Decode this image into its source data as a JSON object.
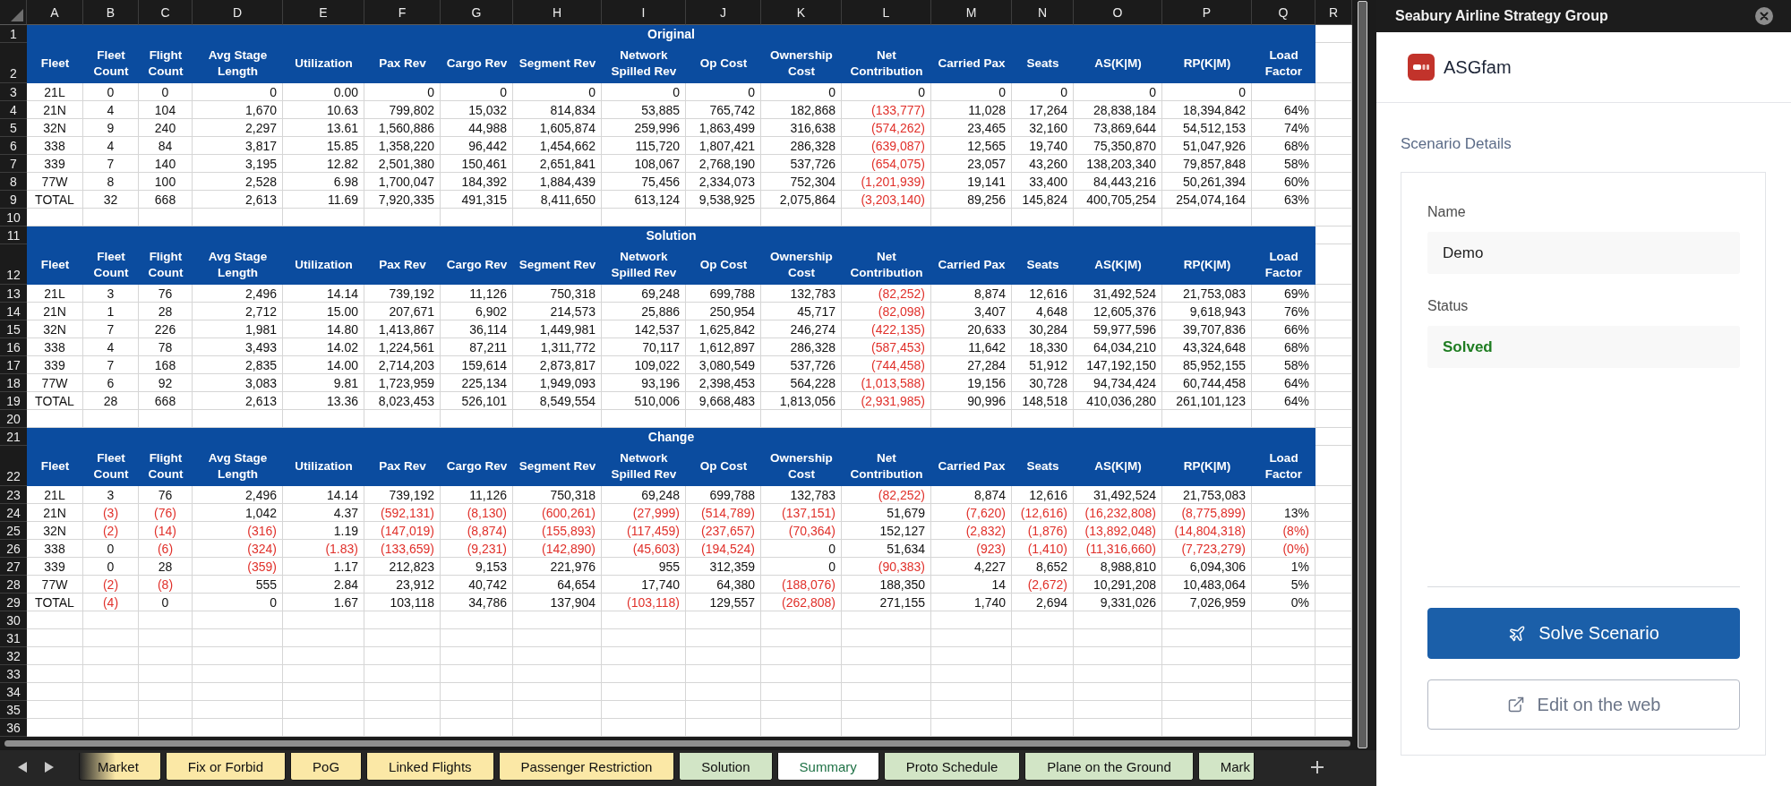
{
  "sheet": {
    "columns": [
      "A",
      "B",
      "C",
      "D",
      "E",
      "F",
      "G",
      "H",
      "I",
      "J",
      "K",
      "L",
      "M",
      "N",
      "O",
      "P",
      "Q",
      "R"
    ],
    "rows": [
      {
        "number": "1",
        "kind": "title",
        "title": "Original"
      },
      {
        "number": "2",
        "kind": "header",
        "cells": [
          "Fleet",
          "Fleet Count",
          "Flight Count",
          "Avg Stage Length",
          "Utilization",
          "Pax Rev",
          "Cargo Rev",
          "Segment Rev",
          "Network Spilled Rev",
          "Op Cost",
          "Ownership Cost",
          "Net Contribution",
          "Carried Pax",
          "Seats",
          "AS(K|M)",
          "RP(K|M)",
          "Load Factor"
        ]
      },
      {
        "number": "3",
        "kind": "data",
        "cells": [
          "21L",
          "0",
          "0",
          "0",
          "0.00",
          "0",
          "0",
          "0",
          "0",
          "0",
          "0",
          "0",
          "0",
          "0",
          "0",
          "0"
        ],
        "negative": [
          false,
          false,
          false,
          false,
          false,
          false,
          false,
          false,
          false,
          false,
          false,
          false,
          false,
          false,
          false,
          false
        ]
      },
      {
        "number": "4",
        "kind": "data",
        "cells": [
          "21N",
          "4",
          "104",
          "1,670",
          "10.63",
          "799,802",
          "15,032",
          "814,834",
          "53,885",
          "765,742",
          "182,868",
          "(133,777)",
          "11,028",
          "17,264",
          "28,838,184",
          "18,394,842",
          "64%"
        ],
        "negative": [
          false,
          false,
          false,
          false,
          false,
          false,
          false,
          false,
          false,
          false,
          false,
          true,
          false,
          false,
          false,
          false,
          false
        ]
      },
      {
        "number": "5",
        "kind": "data",
        "cells": [
          "32N",
          "9",
          "240",
          "2,297",
          "13.61",
          "1,560,886",
          "44,988",
          "1,605,874",
          "259,996",
          "1,863,499",
          "316,638",
          "(574,262)",
          "23,465",
          "32,160",
          "73,869,644",
          "54,512,153",
          "74%"
        ],
        "negative": [
          false,
          false,
          false,
          false,
          false,
          false,
          false,
          false,
          false,
          false,
          false,
          true,
          false,
          false,
          false,
          false,
          false
        ]
      },
      {
        "number": "6",
        "kind": "data",
        "cells": [
          "338",
          "4",
          "84",
          "3,817",
          "15.85",
          "1,358,220",
          "96,442",
          "1,454,662",
          "115,720",
          "1,807,421",
          "286,328",
          "(639,087)",
          "12,565",
          "19,740",
          "75,350,870",
          "51,047,926",
          "68%"
        ],
        "negative": [
          false,
          false,
          false,
          false,
          false,
          false,
          false,
          false,
          false,
          false,
          false,
          true,
          false,
          false,
          false,
          false,
          false
        ]
      },
      {
        "number": "7",
        "kind": "data",
        "cells": [
          "339",
          "7",
          "140",
          "3,195",
          "12.82",
          "2,501,380",
          "150,461",
          "2,651,841",
          "108,067",
          "2,768,190",
          "537,726",
          "(654,075)",
          "23,057",
          "43,260",
          "138,203,340",
          "79,857,848",
          "58%"
        ],
        "negative": [
          false,
          false,
          false,
          false,
          false,
          false,
          false,
          false,
          false,
          false,
          false,
          true,
          false,
          false,
          false,
          false,
          false
        ]
      },
      {
        "number": "8",
        "kind": "data",
        "cells": [
          "77W",
          "8",
          "100",
          "2,528",
          "6.98",
          "1,700,047",
          "184,392",
          "1,884,439",
          "75,456",
          "2,334,073",
          "752,304",
          "(1,201,939)",
          "19,141",
          "33,400",
          "84,443,216",
          "50,261,394",
          "60%"
        ],
        "negative": [
          false,
          false,
          false,
          false,
          false,
          false,
          false,
          false,
          false,
          false,
          false,
          true,
          false,
          false,
          false,
          false,
          false
        ]
      },
      {
        "number": "9",
        "kind": "data",
        "cells": [
          "TOTAL",
          "32",
          "668",
          "2,613",
          "11.69",
          "7,920,335",
          "491,315",
          "8,411,650",
          "613,124",
          "9,538,925",
          "2,075,864",
          "(3,203,140)",
          "89,256",
          "145,824",
          "400,705,254",
          "254,074,164",
          "63%"
        ],
        "negative": [
          false,
          false,
          false,
          false,
          false,
          false,
          false,
          false,
          false,
          false,
          false,
          true,
          false,
          false,
          false,
          false,
          false
        ]
      },
      {
        "number": "10",
        "kind": "empty"
      },
      {
        "number": "11",
        "kind": "title",
        "title": "Solution"
      },
      {
        "number": "12",
        "kind": "header",
        "cells": [
          "Fleet",
          "Fleet Count",
          "Flight Count",
          "Avg Stage Length",
          "Utilization",
          "Pax Rev",
          "Cargo Rev",
          "Segment Rev",
          "Network Spilled Rev",
          "Op Cost",
          "Ownership Cost",
          "Net Contribution",
          "Carried Pax",
          "Seats",
          "AS(K|M)",
          "RP(K|M)",
          "Load Factor"
        ]
      },
      {
        "number": "13",
        "kind": "data",
        "cells": [
          "21L",
          "3",
          "76",
          "2,496",
          "14.14",
          "739,192",
          "11,126",
          "750,318",
          "69,248",
          "699,788",
          "132,783",
          "(82,252)",
          "8,874",
          "12,616",
          "31,492,524",
          "21,753,083",
          "69%"
        ],
        "negative": [
          false,
          false,
          false,
          false,
          false,
          false,
          false,
          false,
          false,
          false,
          false,
          true,
          false,
          false,
          false,
          false,
          false
        ]
      },
      {
        "number": "14",
        "kind": "data",
        "cells": [
          "21N",
          "1",
          "28",
          "2,712",
          "15.00",
          "207,671",
          "6,902",
          "214,573",
          "25,886",
          "250,954",
          "45,717",
          "(82,098)",
          "3,407",
          "4,648",
          "12,605,376",
          "9,618,943",
          "76%"
        ],
        "negative": [
          false,
          false,
          false,
          false,
          false,
          false,
          false,
          false,
          false,
          false,
          false,
          true,
          false,
          false,
          false,
          false,
          false
        ]
      },
      {
        "number": "15",
        "kind": "data",
        "cells": [
          "32N",
          "7",
          "226",
          "1,981",
          "14.80",
          "1,413,867",
          "36,114",
          "1,449,981",
          "142,537",
          "1,625,842",
          "246,274",
          "(422,135)",
          "20,633",
          "30,284",
          "59,977,596",
          "39,707,836",
          "66%"
        ],
        "negative": [
          false,
          false,
          false,
          false,
          false,
          false,
          false,
          false,
          false,
          false,
          false,
          true,
          false,
          false,
          false,
          false,
          false
        ]
      },
      {
        "number": "16",
        "kind": "data",
        "cells": [
          "338",
          "4",
          "78",
          "3,493",
          "14.02",
          "1,224,561",
          "87,211",
          "1,311,772",
          "70,117",
          "1,612,897",
          "286,328",
          "(587,453)",
          "11,642",
          "18,330",
          "64,034,210",
          "43,324,648",
          "68%"
        ],
        "negative": [
          false,
          false,
          false,
          false,
          false,
          false,
          false,
          false,
          false,
          false,
          false,
          true,
          false,
          false,
          false,
          false,
          false
        ]
      },
      {
        "number": "17",
        "kind": "data",
        "cells": [
          "339",
          "7",
          "168",
          "2,835",
          "14.00",
          "2,714,203",
          "159,614",
          "2,873,817",
          "109,022",
          "3,080,549",
          "537,726",
          "(744,458)",
          "27,284",
          "51,912",
          "147,192,150",
          "85,952,155",
          "58%"
        ],
        "negative": [
          false,
          false,
          false,
          false,
          false,
          false,
          false,
          false,
          false,
          false,
          false,
          true,
          false,
          false,
          false,
          false,
          false
        ]
      },
      {
        "number": "18",
        "kind": "data",
        "cells": [
          "77W",
          "6",
          "92",
          "3,083",
          "9.81",
          "1,723,959",
          "225,134",
          "1,949,093",
          "93,196",
          "2,398,453",
          "564,228",
          "(1,013,588)",
          "19,156",
          "30,728",
          "94,734,424",
          "60,744,458",
          "64%"
        ],
        "negative": [
          false,
          false,
          false,
          false,
          false,
          false,
          false,
          false,
          false,
          false,
          false,
          true,
          false,
          false,
          false,
          false,
          false
        ]
      },
      {
        "number": "19",
        "kind": "data",
        "cells": [
          "TOTAL",
          "28",
          "668",
          "2,613",
          "13.36",
          "8,023,453",
          "526,101",
          "8,549,554",
          "510,006",
          "9,668,483",
          "1,813,056",
          "(2,931,985)",
          "90,996",
          "148,518",
          "410,036,280",
          "261,101,123",
          "64%"
        ],
        "negative": [
          false,
          false,
          false,
          false,
          false,
          false,
          false,
          false,
          false,
          false,
          false,
          true,
          false,
          false,
          false,
          false,
          false
        ]
      },
      {
        "number": "20",
        "kind": "empty"
      },
      {
        "number": "21",
        "kind": "title",
        "title": "Change"
      },
      {
        "number": "22",
        "kind": "header",
        "cells": [
          "Fleet",
          "Fleet Count",
          "Flight Count",
          "Avg Stage Length",
          "Utilization",
          "Pax Rev",
          "Cargo Rev",
          "Segment Rev",
          "Network Spilled Rev",
          "Op Cost",
          "Ownership Cost",
          "Net Contribution",
          "Carried Pax",
          "Seats",
          "AS(K|M)",
          "RP(K|M)",
          "Load Factor"
        ]
      },
      {
        "number": "23",
        "kind": "data",
        "cells": [
          "21L",
          "3",
          "76",
          "2,496",
          "14.14",
          "739,192",
          "11,126",
          "750,318",
          "69,248",
          "699,788",
          "132,783",
          "(82,252)",
          "8,874",
          "12,616",
          "31,492,524",
          "21,753,083"
        ],
        "negative": [
          false,
          false,
          false,
          false,
          false,
          false,
          false,
          false,
          false,
          false,
          false,
          true,
          false,
          false,
          false,
          false
        ]
      },
      {
        "number": "24",
        "kind": "data",
        "cells": [
          "21N",
          "(3)",
          "(76)",
          "1,042",
          "4.37",
          "(592,131)",
          "(8,130)",
          "(600,261)",
          "(27,999)",
          "(514,789)",
          "(137,151)",
          "51,679",
          "(7,620)",
          "(12,616)",
          "(16,232,808)",
          "(8,775,899)",
          "13%"
        ],
        "negative": [
          false,
          true,
          true,
          false,
          false,
          true,
          true,
          true,
          true,
          true,
          true,
          false,
          true,
          true,
          true,
          true,
          false
        ]
      },
      {
        "number": "25",
        "kind": "data",
        "cells": [
          "32N",
          "(2)",
          "(14)",
          "(316)",
          "1.19",
          "(147,019)",
          "(8,874)",
          "(155,893)",
          "(117,459)",
          "(237,657)",
          "(70,364)",
          "152,127",
          "(2,832)",
          "(1,876)",
          "(13,892,048)",
          "(14,804,318)",
          "(8%)"
        ],
        "negative": [
          false,
          true,
          true,
          true,
          false,
          true,
          true,
          true,
          true,
          true,
          true,
          false,
          true,
          true,
          true,
          true,
          true
        ]
      },
      {
        "number": "26",
        "kind": "data",
        "cells": [
          "338",
          "0",
          "(6)",
          "(324)",
          "(1.83)",
          "(133,659)",
          "(9,231)",
          "(142,890)",
          "(45,603)",
          "(194,524)",
          "0",
          "51,634",
          "(923)",
          "(1,410)",
          "(11,316,660)",
          "(7,723,279)",
          "(0%)"
        ],
        "negative": [
          false,
          false,
          true,
          true,
          true,
          true,
          true,
          true,
          true,
          true,
          false,
          false,
          true,
          true,
          true,
          true,
          true
        ]
      },
      {
        "number": "27",
        "kind": "data",
        "cells": [
          "339",
          "0",
          "28",
          "(359)",
          "1.17",
          "212,823",
          "9,153",
          "221,976",
          "955",
          "312,359",
          "0",
          "(90,383)",
          "4,227",
          "8,652",
          "8,988,810",
          "6,094,306",
          "1%"
        ],
        "negative": [
          false,
          false,
          false,
          true,
          false,
          false,
          false,
          false,
          false,
          false,
          false,
          true,
          false,
          false,
          false,
          false,
          false
        ]
      },
      {
        "number": "28",
        "kind": "data",
        "cells": [
          "77W",
          "(2)",
          "(8)",
          "555",
          "2.84",
          "23,912",
          "40,742",
          "64,654",
          "17,740",
          "64,380",
          "(188,076)",
          "188,350",
          "14",
          "(2,672)",
          "10,291,208",
          "10,483,064",
          "5%"
        ],
        "negative": [
          false,
          true,
          true,
          false,
          false,
          false,
          false,
          false,
          false,
          false,
          true,
          false,
          false,
          true,
          false,
          false,
          false
        ]
      },
      {
        "number": "29",
        "kind": "data",
        "cells": [
          "TOTAL",
          "(4)",
          "0",
          "0",
          "1.67",
          "103,118",
          "34,786",
          "137,904",
          "(103,118)",
          "129,557",
          "(262,808)",
          "271,155",
          "1,740",
          "2,694",
          "9,331,026",
          "7,026,959",
          "0%"
        ],
        "negative": [
          false,
          true,
          false,
          false,
          false,
          false,
          false,
          false,
          true,
          false,
          true,
          false,
          false,
          false,
          false,
          false,
          false
        ]
      },
      {
        "number": "30",
        "kind": "empty"
      },
      {
        "number": "31",
        "kind": "empty"
      },
      {
        "number": "32",
        "kind": "empty"
      },
      {
        "number": "33",
        "kind": "empty"
      },
      {
        "number": "34",
        "kind": "empty"
      },
      {
        "number": "35",
        "kind": "empty"
      },
      {
        "number": "36",
        "kind": "empty"
      }
    ]
  },
  "tabs": [
    {
      "label": "Market",
      "color": "#fbe8a6",
      "selected": false
    },
    {
      "label": "Fix or Forbid",
      "color": "#fbe8a6",
      "selected": false
    },
    {
      "label": "PoG",
      "color": "#fbe8a6",
      "selected": false
    },
    {
      "label": "Linked Flights",
      "color": "#fbe8a6",
      "selected": false
    },
    {
      "label": "Passenger Restriction",
      "color": "#fbe8a6",
      "selected": false
    },
    {
      "label": "Solution",
      "color": "#d2e5c6",
      "selected": false
    },
    {
      "label": "Summary",
      "selected": true
    },
    {
      "label": "Proto Schedule",
      "color": "#d2e5c6",
      "selected": false
    },
    {
      "label": "Plane on the Ground",
      "color": "#d2e5c6",
      "selected": false
    },
    {
      "label": "Mark",
      "color": "#d2e5c6",
      "selected": false
    }
  ],
  "panel": {
    "title": "Seabury Airline Strategy Group",
    "app_name": "ASGfam",
    "section_title": "Scenario Details",
    "fields": [
      {
        "label": "Name",
        "value": "Demo",
        "kind": "text"
      },
      {
        "label": "Status",
        "value": "Solved",
        "kind": "status"
      }
    ],
    "buttons": [
      {
        "label": "Solve Scenario",
        "kind": "primary"
      },
      {
        "label": "Edit on the web",
        "kind": "secondary"
      }
    ]
  }
}
